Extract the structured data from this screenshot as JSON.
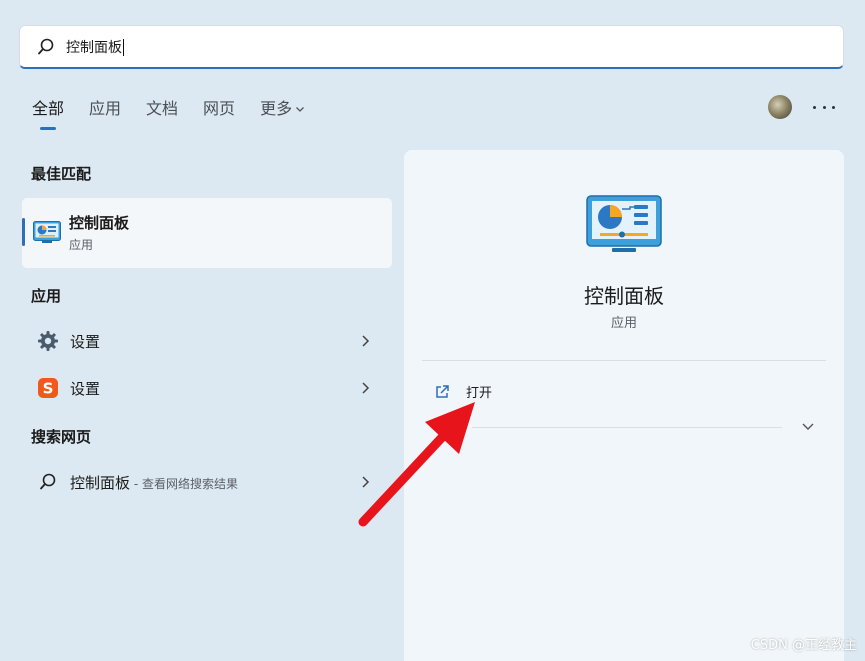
{
  "search": {
    "query": "控制面板"
  },
  "tabs": [
    {
      "label": "全部"
    },
    {
      "label": "应用"
    },
    {
      "label": "文档"
    },
    {
      "label": "网页"
    },
    {
      "label": "更多"
    }
  ],
  "sections": {
    "best_match": "最佳匹配",
    "apps": "应用",
    "web": "搜索网页"
  },
  "best_match": {
    "name": "控制面板",
    "type": "应用"
  },
  "apps": [
    {
      "label": "设置",
      "icon": "settings-gear-icon"
    },
    {
      "label": "设置",
      "icon": "sogou-s-icon"
    }
  ],
  "web_result": {
    "query": "控制面板",
    "hint": " - 查看网络搜索结果"
  },
  "detail": {
    "name": "控制面板",
    "type": "应用",
    "open_label": "打开"
  },
  "colors": {
    "accent": "#2f6fb8",
    "annotation_arrow": "#e8141b",
    "background": "#dde9f2"
  },
  "watermark": "CSDN @正经教主"
}
